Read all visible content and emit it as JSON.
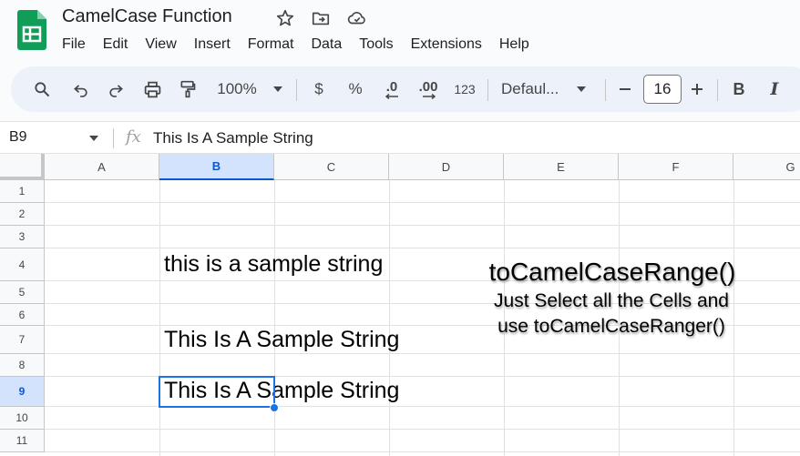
{
  "app": {
    "doc_title": "CamelCase Function",
    "brand_color": "#0f9d58"
  },
  "menu": [
    "File",
    "Edit",
    "View",
    "Insert",
    "Format",
    "Data",
    "Tools",
    "Extensions",
    "Help"
  ],
  "toolbar": {
    "zoom": "100%",
    "currency": "$",
    "percent": "%",
    "decrease_decimal": ".0",
    "increase_decimal": ".00",
    "number_format": "123",
    "font": "Defaul...",
    "font_size": "16",
    "bold": "B",
    "italic": "I"
  },
  "formula_bar": {
    "cell_ref": "B9",
    "fx": "fx",
    "value": "This Is A Sample String"
  },
  "grid": {
    "columns": [
      "A",
      "B",
      "C",
      "D",
      "E",
      "F",
      "G"
    ],
    "rows": [
      "1",
      "2",
      "3",
      "4",
      "5",
      "6",
      "7",
      "8",
      "9",
      "10",
      "11"
    ],
    "selected_column": "B",
    "selected_row": "9",
    "cells": {
      "B4": "this is a sample string",
      "B7": "This Is A Sample String",
      "B9": "This Is A Sample String"
    }
  },
  "overlay": {
    "title": "toCamelCaseRange()",
    "line1": "Just Select all the Cells and",
    "line2": "use toCamelCaseRanger()"
  }
}
